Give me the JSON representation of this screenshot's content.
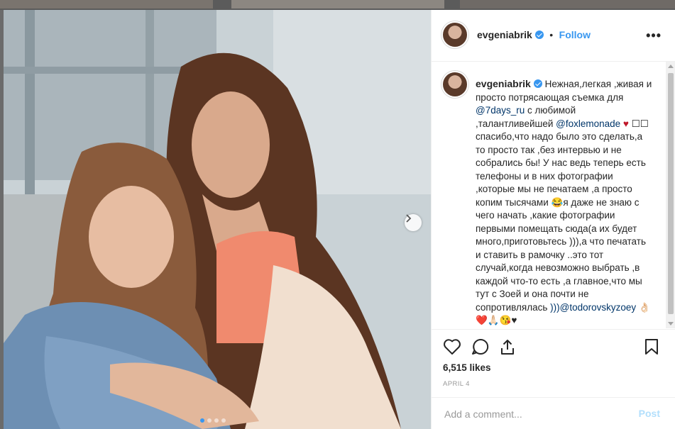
{
  "post": {
    "username": "evgeniabrik",
    "verified": true,
    "follow_label": "Follow",
    "dot_separator": "•",
    "more_label": "•••",
    "caption_parts": [
      {
        "type": "text",
        "value": "Нежная,легкая ,живая и просто потрясающая съемка для "
      },
      {
        "type": "link",
        "value": "@7days_ru"
      },
      {
        "type": "text",
        "value": " с любимой ,талантливейшей "
      },
      {
        "type": "link",
        "value": "@foxlemonade"
      },
      {
        "type": "heart",
        "value": " ♥"
      },
      {
        "type": "text",
        "value": " ☐☐ спасибо,что надо было это сделать,а то просто так ,без интервью и не собрались бы! У нас ведь теперь есть телефоны и в них фотографии ,которые мы не печатаем ,а просто копим тысячами 😂я даже не знаю с чего начать ,какие фотографии первыми помещать сюда(а их будет много,приготовьтесь ))),а что печатать и ставить в рамочку ..это тот случай,когда невозможно выбрать ,в каждой что-то есть ,а главное,что мы тут с Зоей и она почти не сопротивлялась "
      },
      {
        "type": "link",
        "value": ")))@todorovskyzoey"
      },
      {
        "type": "text",
        "value": " 👌🏻❤️🙏🏻😘♥"
      }
    ],
    "likes": "6,515 likes",
    "date": "APRIL 4",
    "comment_placeholder": "Add a comment...",
    "post_label": "Post",
    "carousel": {
      "total": 4,
      "active": 0
    }
  },
  "colors": {
    "accent": "#3897f0",
    "link": "#003569",
    "text": "#262626",
    "muted": "#999999"
  },
  "icons": {
    "more": "ellipsis-icon",
    "like": "heart-outline-icon",
    "comment": "speech-bubble-icon",
    "share": "share-arrow-icon",
    "save": "bookmark-icon",
    "next": "chevron-right-icon"
  }
}
